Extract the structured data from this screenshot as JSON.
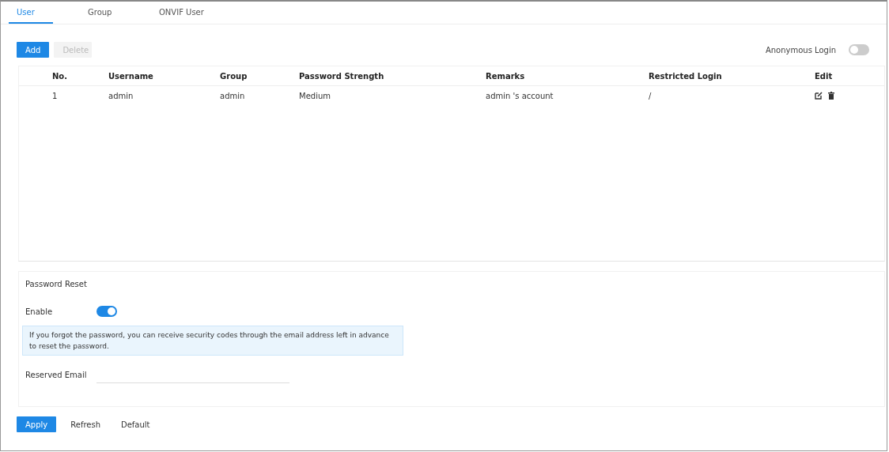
{
  "tabs": [
    {
      "label": "User",
      "selected": true
    },
    {
      "label": "Group",
      "selected": false
    },
    {
      "label": "ONVIF User",
      "selected": false
    }
  ],
  "toolbar": {
    "buttons": [
      {
        "label": "Add",
        "primary": true,
        "disabled": false
      },
      {
        "label": "Delete",
        "primary": false,
        "disabled": true
      }
    ],
    "anonymous_login": {
      "label": "Anonymous Login",
      "on": false
    }
  },
  "table": {
    "columns": [
      "No.",
      "Username",
      "Group",
      "Password Strength",
      "Remarks",
      "Restricted Login",
      "Edit"
    ],
    "rows": [
      {
        "cells": [
          "1",
          "admin",
          "admin",
          "Medium",
          "admin 's account",
          "/"
        ]
      }
    ]
  },
  "password_reset": {
    "title": "Password Reset",
    "enable": {
      "label": "Enable",
      "on": true
    },
    "note": "If you forgot the password, you can receive security codes through the email address left in advance to reset the password.",
    "reserved_email": {
      "label": "Reserved Email"
    }
  },
  "footer_buttons": [
    {
      "label": "Apply",
      "primary": true
    },
    {
      "label": "Refresh",
      "primary": false
    },
    {
      "label": "Default",
      "primary": false
    }
  ]
}
